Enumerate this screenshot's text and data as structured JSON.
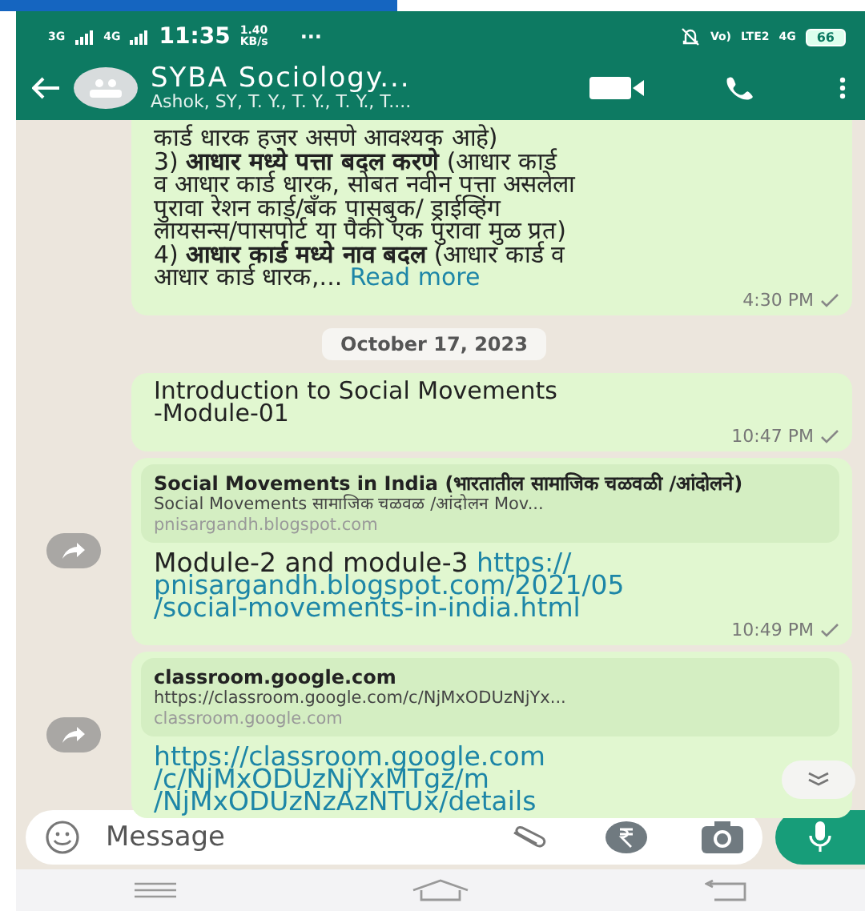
{
  "status_bar": {
    "network_labels": [
      "3G",
      "4G"
    ],
    "time": "11:35",
    "speed": "1.40",
    "speed_unit": "KB/s",
    "more": "···",
    "right_labels": [
      "Vo)",
      "LTE2",
      "4G"
    ],
    "battery": "66"
  },
  "header": {
    "title": "SYBA  Sociology...",
    "subtitle": "Ashok, SY, T. Y., T. Y., T. Y., T...."
  },
  "messages": [
    {
      "kind": "text",
      "lines": [
        "कार्ड धारक हजर असणे आवश्यक आहे)",
        "3) **आधार मध्ये पत्ता बदल करणे** (आधार कार्ड",
        "व आधार कार्ड धारक, सोबत नवीन पत्ता असलेला",
        "पुरावा रेशन कार्ड/बँक पासबुक/ ड्राईव्हिंग",
        "लायसन्स/पासपोर्ट या पैकी एक पुरावा मुळ प्रत)",
        "4) **आधार कार्ड मध्ये नाव बदल** (आधार कार्ड व",
        "आधार कार्ड धारक,..."
      ],
      "read_more": "Read more",
      "time": "4:30 PM"
    },
    {
      "kind": "date",
      "label": "October 17, 2023"
    },
    {
      "kind": "text",
      "lines": [
        "Introduction to Social Movements",
        "-Module-01"
      ],
      "time": "10:47 PM"
    },
    {
      "kind": "link",
      "preview": {
        "title": "Social Movements in India (भारतातील सामाजिक चळवळी /आंदोलने)",
        "description": "Social Movements सामाजिक चळवळ /आंदोलन Mov...",
        "domain": "pnisargandh.blogspot.com"
      },
      "text": "Module-2 and module-3 ",
      "link_lines": [
        "https://",
        "pnisargandh.blogspot.com/2021/05",
        "/social-movements-in-india.html"
      ],
      "time": "10:49 PM"
    },
    {
      "kind": "link",
      "preview": {
        "title": "classroom.google.com",
        "description": "https://classroom.google.com/c/NjMxODUzNjYx...",
        "domain": "classroom.google.com"
      },
      "link_lines": [
        "https://classroom.google.com",
        "/c/NjMxODUzNjYxMTgz/m",
        "/NjMxODUzNzAzNTUx/details"
      ]
    }
  ],
  "composer": {
    "placeholder": "Message"
  }
}
